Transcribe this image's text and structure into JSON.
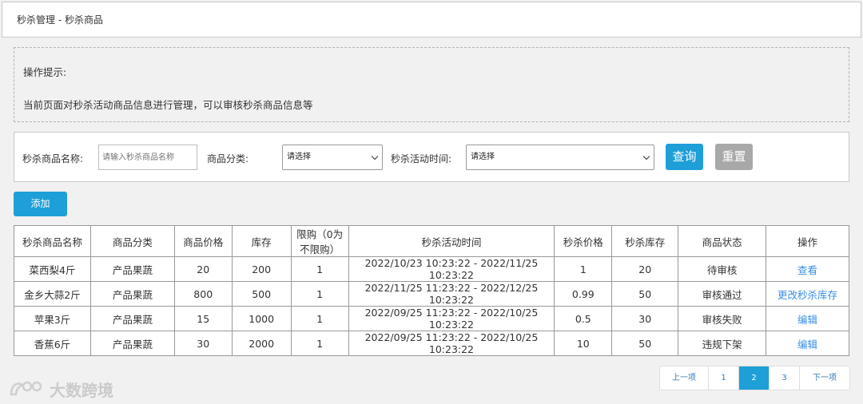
{
  "breadcrumb": "秒杀管理 - 秒杀商品",
  "tips": {
    "title": "操作提示:",
    "content": "当前页面对秒杀活动商品信息进行管理，可以审核秒杀商品信息等"
  },
  "search": {
    "name_label": "秒杀商品名称:",
    "name_placeholder": "请输入秒杀商品名称",
    "category_label": "商品分类:",
    "category_value": "请选择",
    "time_label": "秒杀活动时间:",
    "time_value": "请选择",
    "query_label": "查询",
    "reset_label": "重置"
  },
  "add_label": "添加",
  "table": {
    "headers": [
      "秒杀商品名称",
      "商品分类",
      "商品价格",
      "库存",
      "限购（0为不限购）",
      "秒杀活动时间",
      "秒杀价格",
      "秒杀库存",
      "商品状态",
      "操作"
    ],
    "rows": [
      [
        "菜西梨4斤",
        "产品果蔬",
        "20",
        "200",
        "1",
        "2022/10/23 10:23:22 - 2022/11/25 10:23:22",
        "1",
        "20",
        "待审核",
        "查看"
      ],
      [
        "金乡大蒜2斤",
        "产品果蔬",
        "800",
        "500",
        "1",
        "2022/11/25 11:23:22 - 2022/12/25 10:23:22",
        "0.99",
        "50",
        "审核通过",
        "更改秒杀库存"
      ],
      [
        "苹果3斤",
        "产品果蔬",
        "15",
        "1000",
        "1",
        "2022/09/25 11:23:22 - 2022/10/25 10:23:22",
        "0.5",
        "30",
        "审核失败",
        "编辑"
      ],
      [
        "香蕉6斤",
        "产品果蔬",
        "30",
        "2000",
        "1",
        "2022/09/25 11:23:22 - 2022/10/25 10:23:22",
        "10",
        "50",
        "违规下架",
        "编辑"
      ]
    ]
  },
  "pagination": {
    "prev": "上一项",
    "pages": [
      "1",
      "2",
      "3"
    ],
    "active": "2",
    "next": "下一项"
  },
  "watermark": "大数跨境",
  "colors": {
    "primary": "#1e9fd8",
    "reset": "#a8a8a8",
    "link": "#3a8ee6"
  }
}
